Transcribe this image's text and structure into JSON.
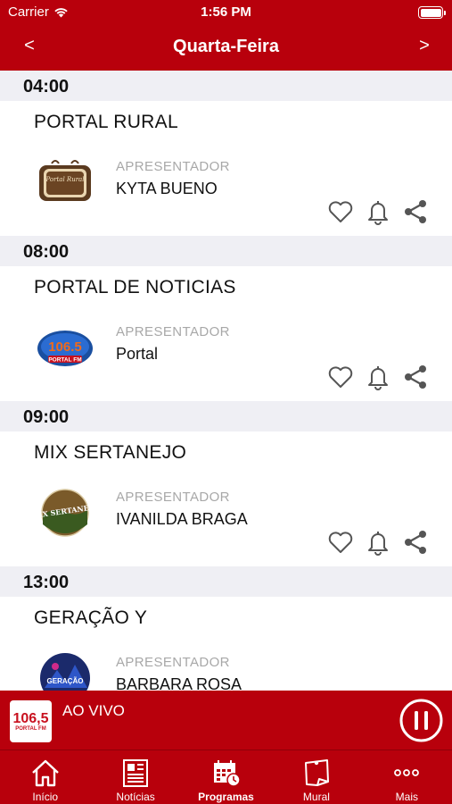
{
  "status": {
    "carrier": "Carrier",
    "time": "1:56 PM"
  },
  "header": {
    "title": "Quarta-Feira",
    "prev": "<",
    "next": ">"
  },
  "programs": [
    {
      "time": "04:00",
      "name": "PORTAL RURAL",
      "role": "APRESENTADOR",
      "host": "KYTA BUENO",
      "logo_text": "Portal Rural"
    },
    {
      "time": "08:00",
      "name": "PORTAL DE NOTICIAS",
      "role": "APRESENTADOR",
      "host": "Portal",
      "logo_text": "106.5 PORTAL FM"
    },
    {
      "time": "09:00",
      "name": "MIX SERTANEJO",
      "role": "APRESENTADOR",
      "host": "IVANILDA BRAGA",
      "logo_text": "MIX SERTANEJO"
    },
    {
      "time": "13:00",
      "name": "GERAÇÃO Y",
      "role": "APRESENTADOR",
      "host": "BARBARA ROSA",
      "logo_text": "GERAÇÃO"
    }
  ],
  "player": {
    "logo_num": "106,5",
    "logo_sub": "PORTAL FM",
    "label": "AO VIVO"
  },
  "tabs": [
    {
      "label": "Início",
      "icon": "home-icon"
    },
    {
      "label": "Notícias",
      "icon": "newspaper-icon"
    },
    {
      "label": "Programas",
      "icon": "calendar-icon",
      "active": true
    },
    {
      "label": "Mural",
      "icon": "note-icon"
    },
    {
      "label": "Mais",
      "icon": "more-icon"
    }
  ],
  "colors": {
    "brand": "#b8000c",
    "section_bg": "#efeff4",
    "role_gray": "#a8a8a8"
  }
}
